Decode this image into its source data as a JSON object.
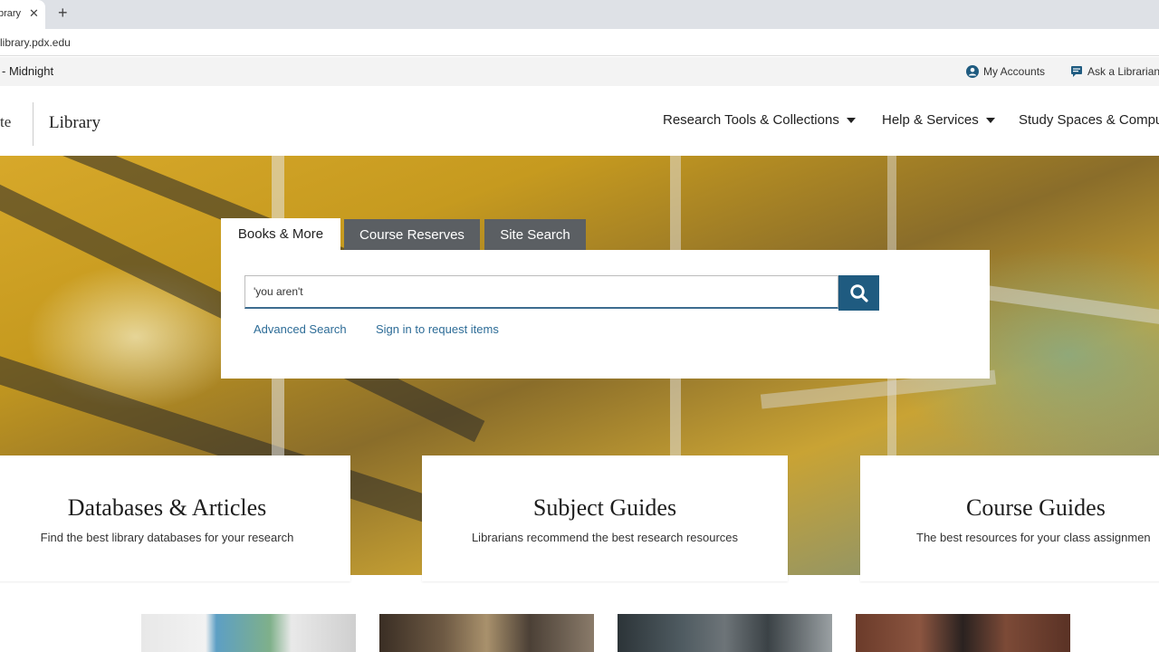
{
  "browser": {
    "tab_title": "brary",
    "tab_close": "✕",
    "new_tab": "+",
    "url": "library.pdx.edu"
  },
  "utility": {
    "hours": "- Midnight",
    "accounts": "My Accounts",
    "ask": "Ask a Librarian"
  },
  "header": {
    "logo_fragment": "te",
    "library_word": "Library",
    "nav": [
      "Research Tools & Collections",
      "Help & Services",
      "Study Spaces & Compu"
    ]
  },
  "search": {
    "tabs": [
      "Books & More",
      "Course Reserves",
      "Site Search"
    ],
    "query": "'you aren't ",
    "advanced": "Advanced Search",
    "signin": "Sign in to request items"
  },
  "cards": [
    {
      "title": "Databases & Articles",
      "subtitle": "Find the best library databases for your research"
    },
    {
      "title": "Subject Guides",
      "subtitle": "Librarians recommend the best research resources"
    },
    {
      "title": "Course Guides",
      "subtitle": "The best resources for your class assignmen"
    }
  ],
  "colors": {
    "accent": "#1f5b80",
    "link": "#2d6c97",
    "inactive_tab": "#5b5f63"
  }
}
